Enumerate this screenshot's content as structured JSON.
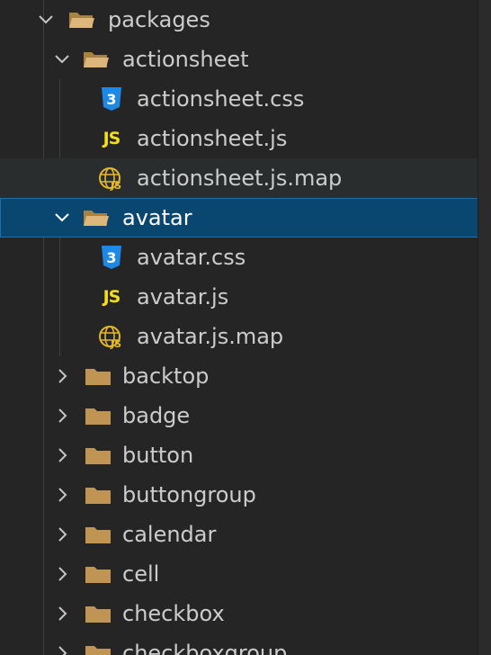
{
  "explorer": {
    "colors": {
      "background": "#252526",
      "selection": "#094771",
      "folder": "#c09553",
      "css_icon": "#1e88e5",
      "js_icon": "#f5de19",
      "map_icon": "#e4b82b",
      "text": "#cccccc",
      "selected_text": "#ffffff"
    },
    "rows": [
      {
        "label": "packages",
        "kind": "folder",
        "expanded": true,
        "icon": "folder-open-icon"
      },
      {
        "label": "actionsheet",
        "kind": "folder",
        "expanded": true,
        "icon": "folder-open-icon"
      },
      {
        "label": "actionsheet.css",
        "kind": "file",
        "icon": "css-file-icon"
      },
      {
        "label": "actionsheet.js",
        "kind": "file",
        "icon": "js-file-icon"
      },
      {
        "label": "actionsheet.js.map",
        "kind": "file",
        "icon": "map-file-icon"
      },
      {
        "label": "avatar",
        "kind": "folder",
        "expanded": true,
        "selected": true,
        "icon": "folder-open-icon"
      },
      {
        "label": "avatar.css",
        "kind": "file",
        "icon": "css-file-icon"
      },
      {
        "label": "avatar.js",
        "kind": "file",
        "icon": "js-file-icon"
      },
      {
        "label": "avatar.js.map",
        "kind": "file",
        "icon": "map-file-icon"
      },
      {
        "label": "backtop",
        "kind": "folder",
        "expanded": false,
        "icon": "folder-icon"
      },
      {
        "label": "badge",
        "kind": "folder",
        "expanded": false,
        "icon": "folder-icon"
      },
      {
        "label": "button",
        "kind": "folder",
        "expanded": false,
        "icon": "folder-icon"
      },
      {
        "label": "buttongroup",
        "kind": "folder",
        "expanded": false,
        "icon": "folder-icon"
      },
      {
        "label": "calendar",
        "kind": "folder",
        "expanded": false,
        "icon": "folder-icon"
      },
      {
        "label": "cell",
        "kind": "folder",
        "expanded": false,
        "icon": "folder-icon"
      },
      {
        "label": "checkbox",
        "kind": "folder",
        "expanded": false,
        "icon": "folder-icon"
      },
      {
        "label": "checkboxgroup",
        "kind": "folder",
        "expanded": false,
        "icon": "folder-icon"
      }
    ]
  }
}
